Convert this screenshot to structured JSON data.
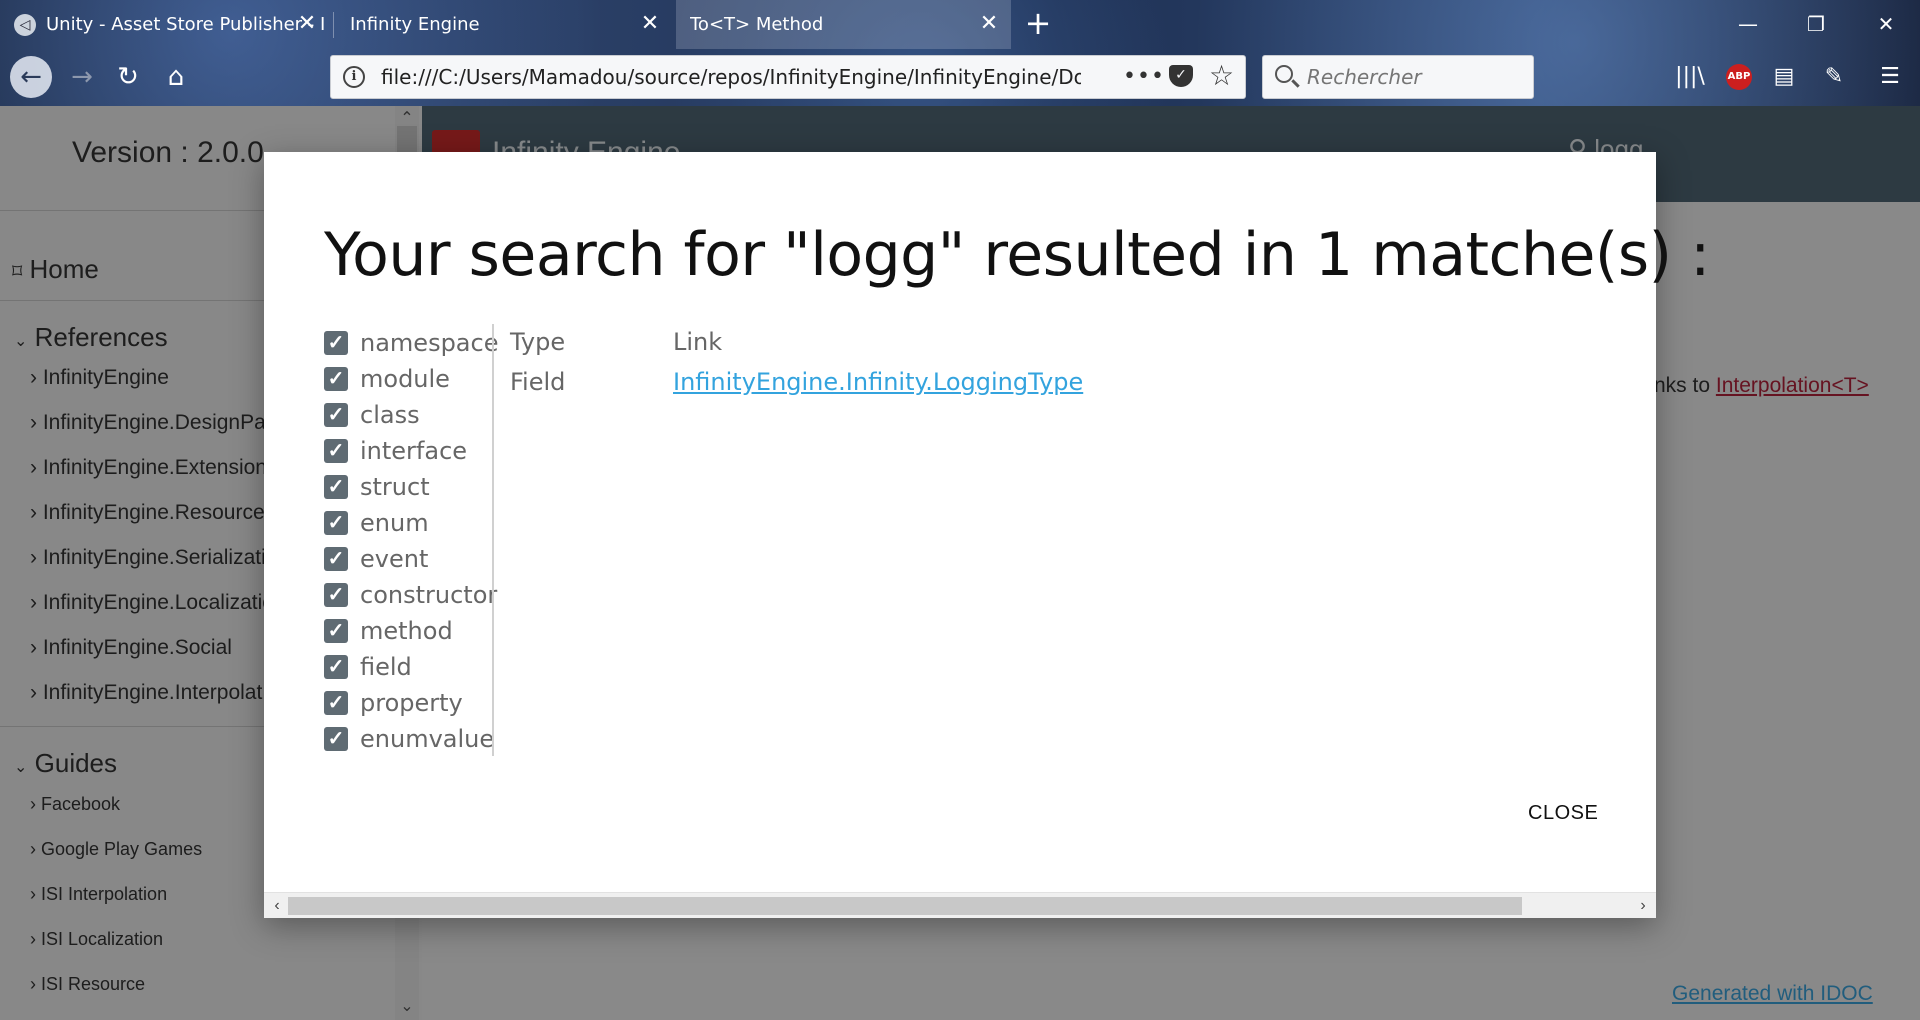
{
  "browser": {
    "tabs": [
      {
        "title": "Unity - Asset Store Publisher - I",
        "icon": "unity-icon"
      },
      {
        "title": "Infinity Engine"
      },
      {
        "title": "To<T> Method",
        "active": true
      }
    ],
    "url": "file:///C:/Users/Mamadou/source/repos/InfinityEngine/InfinityEngine/Doc/In",
    "search_placeholder": "Rechercher",
    "abp_label": "ABP"
  },
  "sidebar": {
    "version": "Version : 2.0.0",
    "home": "Home",
    "references_title": "References",
    "references": [
      "InfinityEngine",
      "InfinityEngine.DesignPat",
      "InfinityEngine.Extension",
      "InfinityEngine.ResourceN",
      "InfinityEngine.Serializati",
      "InfinityEngine.Localizatio",
      "InfinityEngine.Social",
      "InfinityEngine.Interpolat"
    ],
    "guides_title": "Guides",
    "guides": [
      "Facebook",
      "Google Play Games",
      "ISI Interpolation",
      "ISI Localization",
      "ISI Resource"
    ]
  },
  "header": {
    "brand": "Infinity Engine",
    "search_text": "logg"
  },
  "content": {
    "links_prefix": "nks to",
    "links_link": "Interpolation<T>",
    "generated": "Generated with IDOC"
  },
  "modal": {
    "title": "Your search for \"logg\" resulted in 1 matche(s) :",
    "filters": [
      {
        "label": "namespace",
        "checked": true
      },
      {
        "label": "module",
        "checked": true
      },
      {
        "label": "class",
        "checked": true
      },
      {
        "label": "interface",
        "checked": true
      },
      {
        "label": "struct",
        "checked": true
      },
      {
        "label": "enum",
        "checked": true
      },
      {
        "label": "event",
        "checked": true
      },
      {
        "label": "constructor",
        "checked": true
      },
      {
        "label": "method",
        "checked": true
      },
      {
        "label": "field",
        "checked": true
      },
      {
        "label": "property",
        "checked": true
      },
      {
        "label": "enumvalue",
        "checked": true
      }
    ],
    "results_header": {
      "type": "Type",
      "link": "Link"
    },
    "results": [
      {
        "type": "Field",
        "link": "InfinityEngine.Infinity.LoggingType"
      }
    ],
    "close_label": "CLOSE"
  },
  "colors": {
    "header_bg": "#4f6473",
    "link_blue": "#33a3de",
    "link_red": "#b0213a",
    "checkbox": "#5f6b73"
  }
}
